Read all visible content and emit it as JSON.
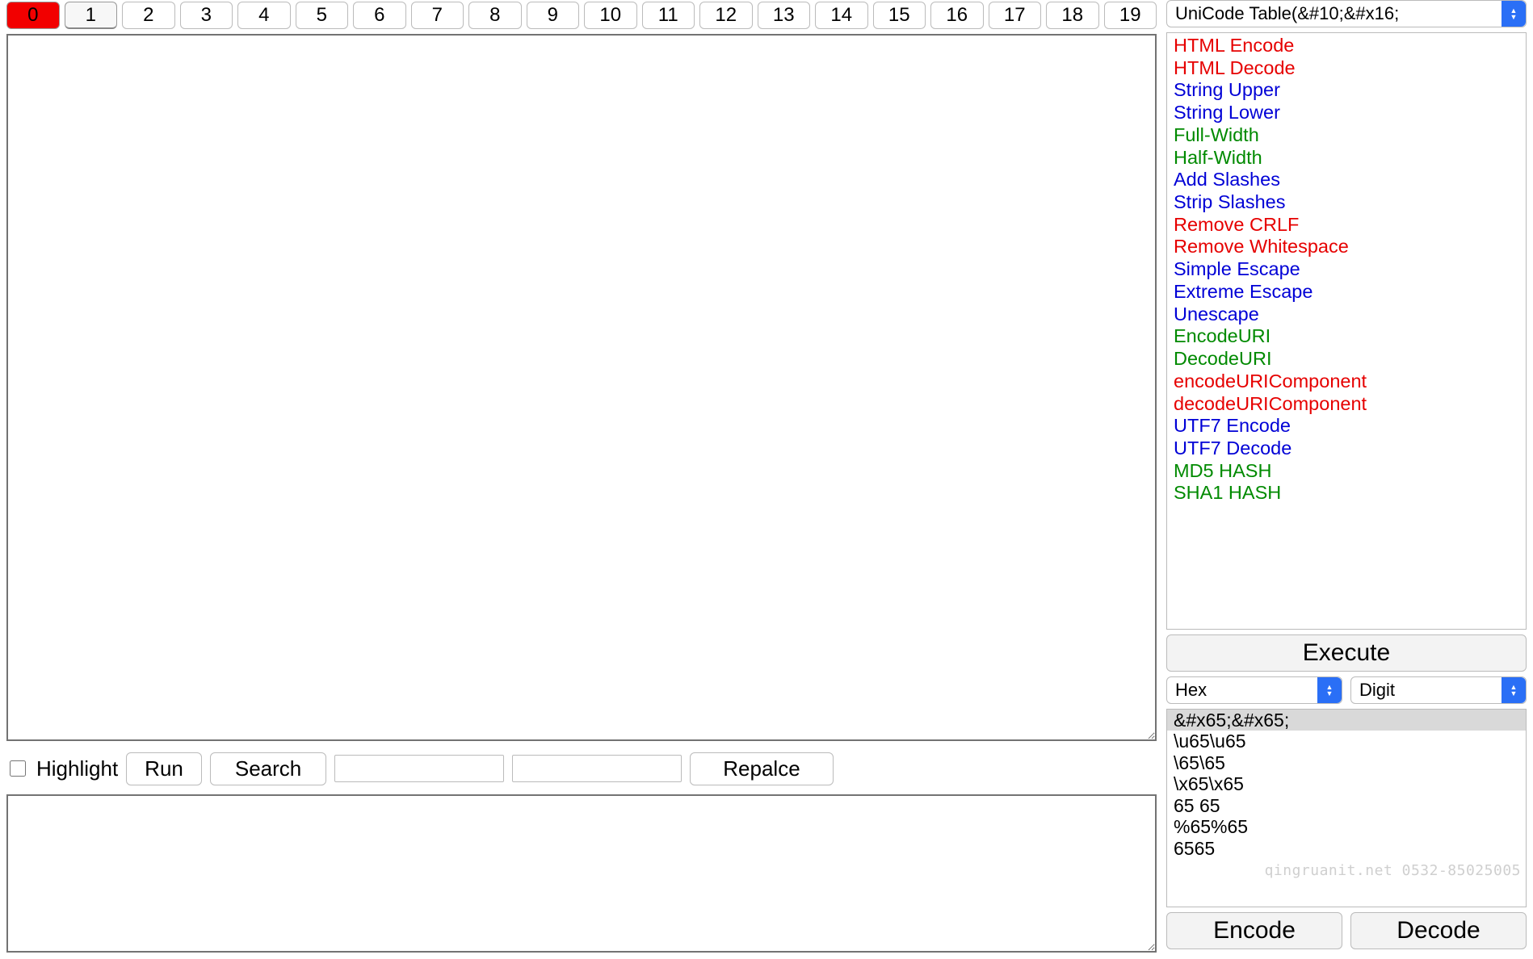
{
  "tabs": {
    "items": [
      "0",
      "1",
      "2",
      "3",
      "4",
      "5",
      "6",
      "7",
      "8",
      "9",
      "10",
      "11",
      "12",
      "13",
      "14",
      "15",
      "16",
      "17",
      "18",
      "19"
    ],
    "active_index": 0,
    "current_index": 1
  },
  "main_text": "",
  "toolbar": {
    "highlight_label": "Highlight",
    "run_label": "Run",
    "search_label": "Search",
    "replace_label": "Repalce",
    "search_value": "",
    "replace_value": ""
  },
  "output_text": "",
  "right": {
    "top_select": {
      "label": "UniCode Table(&#10;&#x16;"
    },
    "operations": [
      {
        "label": "HTML Encode",
        "color": "red"
      },
      {
        "label": "HTML Decode",
        "color": "red"
      },
      {
        "label": "String Upper",
        "color": "blue"
      },
      {
        "label": "String Lower",
        "color": "blue"
      },
      {
        "label": "Full-Width",
        "color": "green"
      },
      {
        "label": "Half-Width",
        "color": "green"
      },
      {
        "label": "Add Slashes",
        "color": "blue"
      },
      {
        "label": "Strip Slashes",
        "color": "blue"
      },
      {
        "label": "Remove CRLF",
        "color": "red"
      },
      {
        "label": "Remove Whitespace",
        "color": "red"
      },
      {
        "label": "Simple Escape",
        "color": "blue"
      },
      {
        "label": "Extreme Escape",
        "color": "blue"
      },
      {
        "label": "Unescape",
        "color": "blue"
      },
      {
        "label": "EncodeURI",
        "color": "green"
      },
      {
        "label": "DecodeURI",
        "color": "green"
      },
      {
        "label": "encodeURIComponent",
        "color": "red"
      },
      {
        "label": "decodeURIComponent",
        "color": "red"
      },
      {
        "label": "UTF7 Encode",
        "color": "blue"
      },
      {
        "label": "UTF7 Decode",
        "color": "blue"
      },
      {
        "label": "MD5 HASH",
        "color": "green"
      },
      {
        "label": "SHA1 HASH",
        "color": "green"
      }
    ],
    "execute_label": "Execute",
    "format_select": {
      "label": "Hex"
    },
    "base_select": {
      "label": "Digit"
    },
    "encoding_lines": [
      {
        "text": "&#x65;&#x65;",
        "selected": true
      },
      {
        "text": "\\u65\\u65",
        "selected": false
      },
      {
        "text": "\\65\\65",
        "selected": false
      },
      {
        "text": "\\x65\\x65",
        "selected": false
      },
      {
        "text": "65 65",
        "selected": false
      },
      {
        "text": "%65%65",
        "selected": false
      },
      {
        "text": "6565",
        "selected": false
      }
    ],
    "encode_label": "Encode",
    "decode_label": "Decode",
    "watermark": "qingruanit.net 0532-85025005"
  }
}
